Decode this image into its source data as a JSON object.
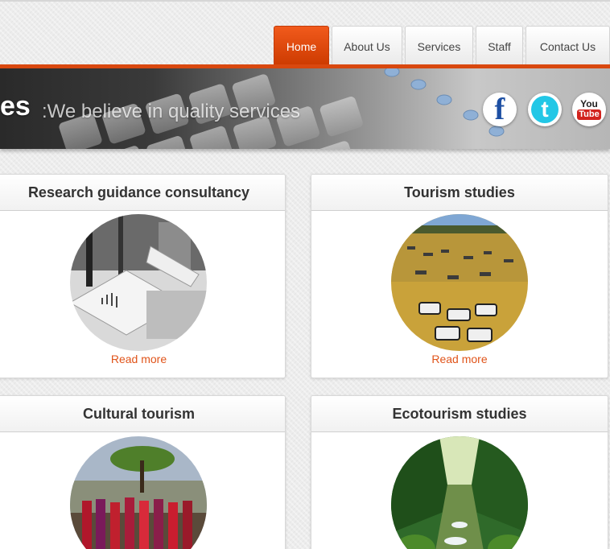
{
  "nav": {
    "items": [
      {
        "label": "Home",
        "active": true
      },
      {
        "label": "About Us"
      },
      {
        "label": "Services"
      },
      {
        "label": "Staff"
      },
      {
        "label": "Contact Us"
      }
    ]
  },
  "banner": {
    "title_fragment": "es",
    "tagline": ":We believe in quality services"
  },
  "social": [
    {
      "name": "facebook-icon",
      "text": "f"
    },
    {
      "name": "twitter-icon",
      "text": "t"
    },
    {
      "name": "youtube-icon",
      "text_top": "You",
      "text_bottom": "Tube"
    }
  ],
  "cards": [
    {
      "title": "Research guidance consultancy",
      "link": "Read more"
    },
    {
      "title": "Tourism studies",
      "link": "Read more"
    },
    {
      "title": "Cultural tourism",
      "link": ""
    },
    {
      "title": "Ecotourism studies",
      "link": ""
    }
  ],
  "colors": {
    "accent": "#e0541a",
    "nav_active": "#f15a1c",
    "nav_bar": "#d9480f"
  }
}
